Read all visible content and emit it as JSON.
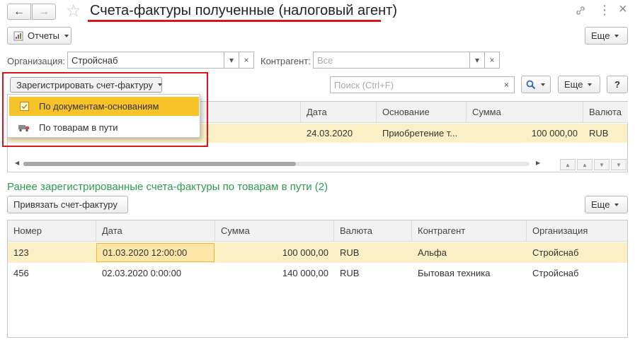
{
  "window": {
    "title": "Счета-фактуры полученные (налоговый агент)",
    "back_icon": "←",
    "forward_icon": "→",
    "star_icon": "☆",
    "link_icon": "🔗",
    "more_icon": "⋮",
    "close_icon": "×"
  },
  "toolbar": {
    "reports_label": "Отчеты",
    "more_label": "Еще"
  },
  "filters": {
    "organization_label": "Организация:",
    "organization_value": "Стройснаб",
    "counterparty_label": "Контрагент:",
    "counterparty_placeholder": "Все",
    "clear_icon": "×",
    "dropdown_icon": "▾"
  },
  "register": {
    "button_label": "Зарегистрировать счет-фактуру",
    "menu_items": [
      {
        "label": "По документам-основаниям",
        "icon": "checkbox-icon"
      },
      {
        "label": "По товарам в пути",
        "icon": "truck-icon"
      }
    ]
  },
  "search": {
    "placeholder": "Поиск (Ctrl+F)",
    "clear_icon": "×",
    "search_icon": "🔍",
    "more_label": "Еще",
    "help_label": "?"
  },
  "top_table": {
    "columns": [
      "Дата",
      "Основание",
      "Сумма",
      "Валюта"
    ],
    "rows": [
      {
        "date": "24.03.2020",
        "basis": "Приобретение т...",
        "sum": "100 000,00",
        "currency": "RUB"
      }
    ]
  },
  "section": {
    "title": "Ранее зарегистрированные счета-фактуры по товарам в пути (2)",
    "title_color": "#2a9d4a",
    "attach_label": "Привязать счет-фактуру",
    "more_label": "Еще"
  },
  "bottom_table": {
    "columns": [
      "Номер",
      "Дата",
      "Сумма",
      "Валюта",
      "Контрагент",
      "Организация"
    ],
    "rows": [
      {
        "number": "123",
        "date": "01.03.2020 12:00:00",
        "sum": "100 000,00",
        "currency": "RUB",
        "counterparty": "Альфа",
        "organization": "Стройснаб"
      },
      {
        "number": "456",
        "date": "02.03.2020 0:00:00",
        "sum": "140 000,00",
        "currency": "RUB",
        "counterparty": "Бытовая техника",
        "organization": "Стройснаб"
      }
    ]
  },
  "colors": {
    "accent_red": "#d9161b",
    "selection_yellow": "#fbf0c5",
    "menu_highlight": "#f6c328"
  }
}
